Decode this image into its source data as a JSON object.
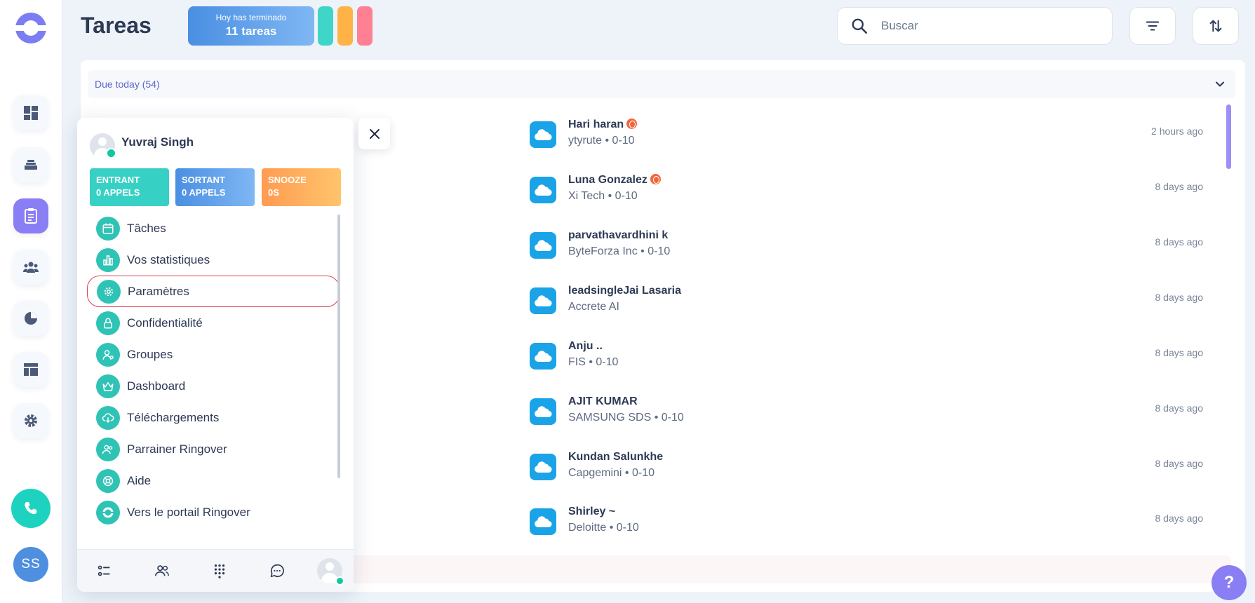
{
  "header": {
    "title": "Tareas",
    "banner_line1": "Hoy has terminado",
    "banner_line2": "11 tareas",
    "search_placeholder": "Buscar",
    "chip_colors": [
      "#3fd5c9",
      "#ffb347",
      "#ff7f93"
    ]
  },
  "rail": {
    "items": [
      {
        "name": "dashboard-icon"
      },
      {
        "name": "inbox-icon"
      },
      {
        "name": "tasks-icon",
        "active": true
      },
      {
        "name": "contacts-icon"
      },
      {
        "name": "analytics-icon"
      },
      {
        "name": "layout-icon"
      },
      {
        "name": "settings-icon"
      }
    ],
    "user_initials": "SS"
  },
  "section": {
    "label": "Due today (54)"
  },
  "tasks": [
    {
      "name": "Hari haran",
      "sub": "ytyrute • 0-10",
      "time": "2 hours ago",
      "hot": true
    },
    {
      "name": "Luna Gonzalez",
      "sub": "Xi Tech • 0-10",
      "time": "8 days ago",
      "hot": true
    },
    {
      "name": "parvathavardhini k",
      "sub": "ByteForza Inc • 0-10",
      "time": "8 days ago",
      "hot": false
    },
    {
      "name": "leadsingleJai Lasaria",
      "sub": "Accrete AI",
      "time": "8 days ago",
      "hot": false
    },
    {
      "name": "Anju ..",
      "sub": "FIS • 0-10",
      "time": "8 days ago",
      "hot": false
    },
    {
      "name": "AJIT KUMAR",
      "sub": "SAMSUNG SDS • 0-10",
      "time": "8 days ago",
      "hot": false
    },
    {
      "name": "Kundan Salunkhe",
      "sub": "Capgemini • 0-10",
      "time": "8 days ago",
      "hot": false
    },
    {
      "name": "Shirley ~",
      "sub": "Deloitte • 0-10",
      "time": "8 days ago",
      "hot": false
    }
  ],
  "popover": {
    "user_name": "Yuvraj Singh",
    "stats": {
      "in_line1": "ENTRANT",
      "in_line2": "0 APPELS",
      "out_line1": "SORTANT",
      "out_line2": "0 APPELS",
      "snooze_line1": "SNOOZE",
      "snooze_line2": "0S"
    },
    "menu": [
      {
        "label": "Tâches",
        "icon": "calendar-icon"
      },
      {
        "label": "Vos statistiques",
        "icon": "bar-chart-icon"
      },
      {
        "label": "Paramètres",
        "icon": "gear-icon",
        "selected": true
      },
      {
        "label": "Confidentialité",
        "icon": "lock-icon"
      },
      {
        "label": "Groupes",
        "icon": "group-icon"
      },
      {
        "label": "Dashboard",
        "icon": "crown-icon"
      },
      {
        "label": "Téléchargements",
        "icon": "cloud-download-icon"
      },
      {
        "label": "Parrainer Ringover",
        "icon": "referral-icon"
      },
      {
        "label": "Aide",
        "icon": "lifebuoy-icon"
      },
      {
        "label": "Vers le portail Ringover",
        "icon": "ringover-logo-icon"
      }
    ]
  },
  "colors": {
    "accent": "#8a7ef4",
    "teal": "#2fc3b5",
    "salesforce": "#1ba3e8",
    "selected_outline": "#e0404f"
  }
}
